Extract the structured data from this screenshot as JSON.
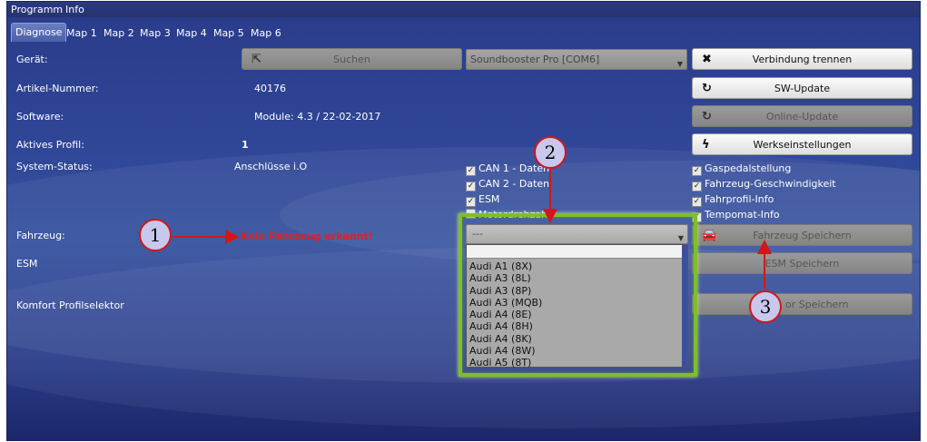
{
  "menu": [
    "Programm",
    "Info"
  ],
  "tabs": [
    "Diagnose",
    "Map 1",
    "Map 2",
    "Map 3",
    "Map 4",
    "Map 5",
    "Map 6"
  ],
  "labels": {
    "geraet": "Gerät:",
    "artikel": "Artikel-Nummer:",
    "software": "Software:",
    "profil": "Aktives Profil:",
    "status": "System-Status:",
    "fahrzeug": "Fahrzeug:",
    "esm": "ESM",
    "komfort": "Komfort Profilselektor"
  },
  "values": {
    "artikel": "40176",
    "software": "Module: 4.3 / 22-02-2017",
    "profil": "1",
    "status": "Anschlüsse i.O",
    "fahrzeug_warning": "Kein Fahrzeug erkannt!"
  },
  "search_button": "Suchen",
  "device_combo": "Soundbooster Pro [COM6]",
  "right_buttons": {
    "disconnect": "Verbindung trennen",
    "sw_update": "SW-Update",
    "online_update": "Online-Update",
    "factory": "Werkseinstellungen",
    "save_vehicle": "Fahrzeug Speichern",
    "save_esm": "ESM Speichern",
    "save_komfort": "or Speichern"
  },
  "checks_mid": [
    "CAN 1 - Daten",
    "CAN 2 - Daten",
    "ESM",
    "Motordrehzahl"
  ],
  "checks_right": [
    "Gaspedalstellung",
    "Fahrzeug-Geschwindigkeit",
    "Fahrprofil-Info",
    "Tempomat-Info"
  ],
  "vehicle_combo": "---",
  "vehicle_options": [
    "Audi A1 (8X)",
    "Audi A3 (8L)",
    "Audi A3 (8P)",
    "Audi A3 (MQB)",
    "Audi A4 (8E)",
    "Audi A4 (8H)",
    "Audi A4 (8K)",
    "Audi A4 (8W)",
    "Audi A5 (8T)"
  ],
  "markers": [
    "1",
    "2",
    "3"
  ],
  "colors": {
    "accent_green": "#7dbf2b",
    "annotation_red": "#d01818",
    "background": "#2f4596"
  }
}
